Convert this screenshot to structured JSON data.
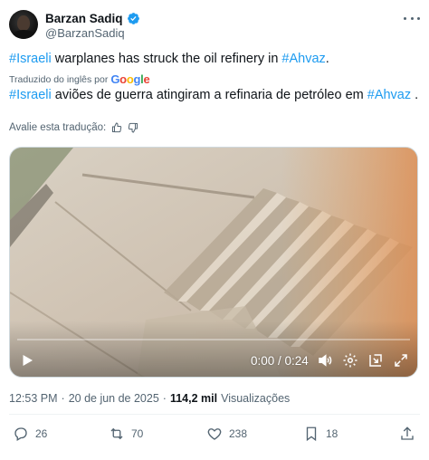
{
  "author": {
    "display_name": "Barzan Sadiq",
    "handle": "@BarzanSadiq",
    "verified_color": "#1d9bf0"
  },
  "tweet": {
    "original": {
      "hashtag_1": "#Israeli",
      "middle": " warplanes has struck the oil refinery in ",
      "hashtag_2": "#Ahvaz",
      "end": "."
    },
    "translated_label": "Traduzido do inglês por",
    "translator_logo": [
      "G",
      "o",
      "o",
      "g",
      "l",
      "e"
    ],
    "translation": {
      "hashtag_1": "#Israeli",
      "middle": " aviões de guerra atingiram a refinaria de petróleo em ",
      "hashtag_2": "#Ahvaz",
      "end": " ."
    },
    "rate_label": "Avalie esta tradução:"
  },
  "video": {
    "time_display": "0:00 / 0:24",
    "progress": 0.0
  },
  "meta": {
    "time": "12:53 PM",
    "separator": "·",
    "date": "20 de jun de 2025",
    "separator2": "·",
    "views_count": "114,2 mil",
    "views_label": "Visualizações"
  },
  "actions": {
    "replies": "26",
    "reposts": "70",
    "likes": "238",
    "bookmarks": "18"
  },
  "colors": {
    "accent": "#1d9bf0",
    "muted": "#536471",
    "text": "#0f1419"
  }
}
